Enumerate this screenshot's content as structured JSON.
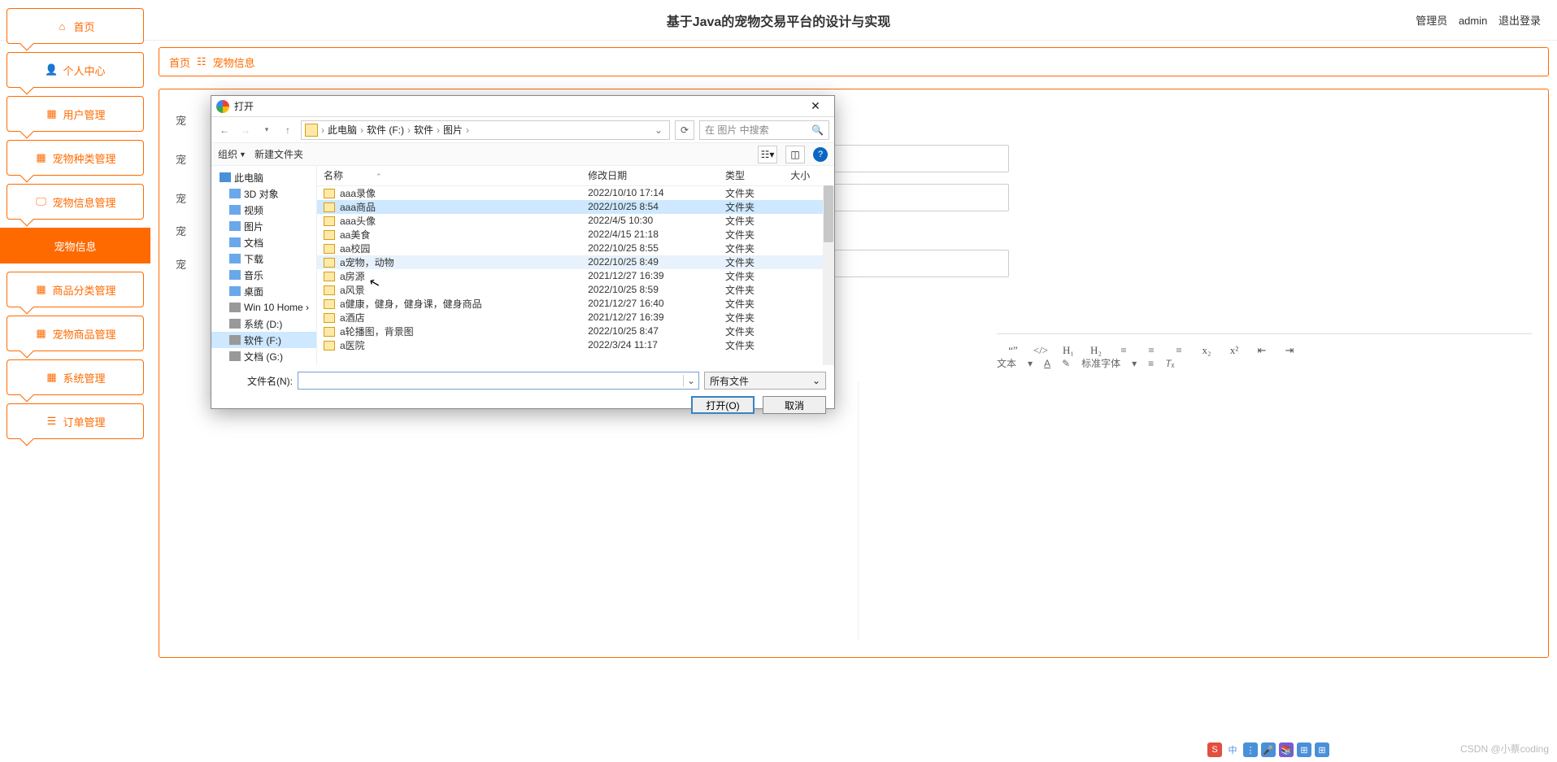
{
  "header": {
    "title": "基于Java的宠物交易平台的设计与实现",
    "role_label": "管理员",
    "username": "admin",
    "logout": "退出登录"
  },
  "sidebar": {
    "items": [
      {
        "label": "首页",
        "icon": "home"
      },
      {
        "label": "个人中心",
        "icon": "person"
      },
      {
        "label": "用户管理",
        "icon": "grid"
      },
      {
        "label": "宠物种类管理",
        "icon": "grid"
      },
      {
        "label": "宠物信息管理",
        "icon": "monitor"
      },
      {
        "label": "宠物信息",
        "icon": "",
        "active": true
      },
      {
        "label": "商品分类管理",
        "icon": "grid"
      },
      {
        "label": "宠物商品管理",
        "icon": "grid"
      },
      {
        "label": "系统管理",
        "icon": "grid"
      },
      {
        "label": "订单管理",
        "icon": "list"
      }
    ]
  },
  "breadcrumb": {
    "home": "首页",
    "sep": "☷",
    "current": "宠物信息"
  },
  "form": {
    "rows": [
      "宠",
      "宠",
      "宠",
      "宠",
      "宠"
    ]
  },
  "rte": {
    "line1": [
      "“”",
      "</>",
      "H₁",
      "H₂",
      "≡",
      "≡",
      "≡",
      "x₂",
      "x²",
      "⇤",
      "⇥"
    ],
    "line2": {
      "text": "文本",
      "font": "标准字体",
      "a": "A",
      "t": "T"
    }
  },
  "file_dialog": {
    "title": "打开",
    "path": [
      "此电脑",
      "软件 (F:)",
      "软件",
      "图片"
    ],
    "search_placeholder": "在 图片 中搜索",
    "toolbar": {
      "organize": "组织",
      "new_folder": "新建文件夹"
    },
    "tree": [
      {
        "label": "此电脑",
        "icon": "pc",
        "lvl": 1
      },
      {
        "label": "3D 对象",
        "icon": "obj",
        "lvl": 2
      },
      {
        "label": "视频",
        "icon": "obj",
        "lvl": 2
      },
      {
        "label": "图片",
        "icon": "obj",
        "lvl": 2
      },
      {
        "label": "文档",
        "icon": "obj",
        "lvl": 2
      },
      {
        "label": "下载",
        "icon": "obj",
        "lvl": 2
      },
      {
        "label": "音乐",
        "icon": "obj",
        "lvl": 2
      },
      {
        "label": "桌面",
        "icon": "obj",
        "lvl": 2
      },
      {
        "label": "Win 10 Home ›",
        "icon": "drive",
        "lvl": 2
      },
      {
        "label": "系统 (D:)",
        "icon": "drive",
        "lvl": 2
      },
      {
        "label": "软件 (F:)",
        "icon": "drive",
        "lvl": 2,
        "sel": true
      },
      {
        "label": "文档 (G:)",
        "icon": "drive",
        "lvl": 2
      }
    ],
    "columns": [
      "名称",
      "修改日期",
      "类型",
      "大小"
    ],
    "rows": [
      {
        "name": "aaa录像",
        "date": "2022/10/10 17:14",
        "type": "文件夹"
      },
      {
        "name": "aaa商品",
        "date": "2022/10/25 8:54",
        "type": "文件夹",
        "sel": true
      },
      {
        "name": "aaa头像",
        "date": "2022/4/5 10:30",
        "type": "文件夹"
      },
      {
        "name": "aa美食",
        "date": "2022/4/15 21:18",
        "type": "文件夹"
      },
      {
        "name": "aa校园",
        "date": "2022/10/25 8:55",
        "type": "文件夹"
      },
      {
        "name": "a宠物，动物",
        "date": "2022/10/25 8:49",
        "type": "文件夹",
        "hover": true
      },
      {
        "name": "a房源",
        "date": "2021/12/27 16:39",
        "type": "文件夹"
      },
      {
        "name": "a风景",
        "date": "2022/10/25 8:59",
        "type": "文件夹"
      },
      {
        "name": "a健康，健身，健身课，健身商品",
        "date": "2021/12/27 16:40",
        "type": "文件夹"
      },
      {
        "name": "a酒店",
        "date": "2021/12/27 16:39",
        "type": "文件夹"
      },
      {
        "name": "a轮播图，背景图",
        "date": "2022/10/25 8:47",
        "type": "文件夹"
      },
      {
        "name": "a医院",
        "date": "2022/3/24 11:17",
        "type": "文件夹"
      }
    ],
    "footer": {
      "filename_label": "文件名(N):",
      "filename_value": "",
      "filter": "所有文件",
      "open": "打开(O)",
      "cancel": "取消"
    }
  },
  "tray": {
    "items": [
      "S",
      "中",
      "⋮",
      "🎤",
      "📚",
      "⊞",
      "⊞"
    ]
  },
  "watermark": "CSDN @小蔡coding"
}
